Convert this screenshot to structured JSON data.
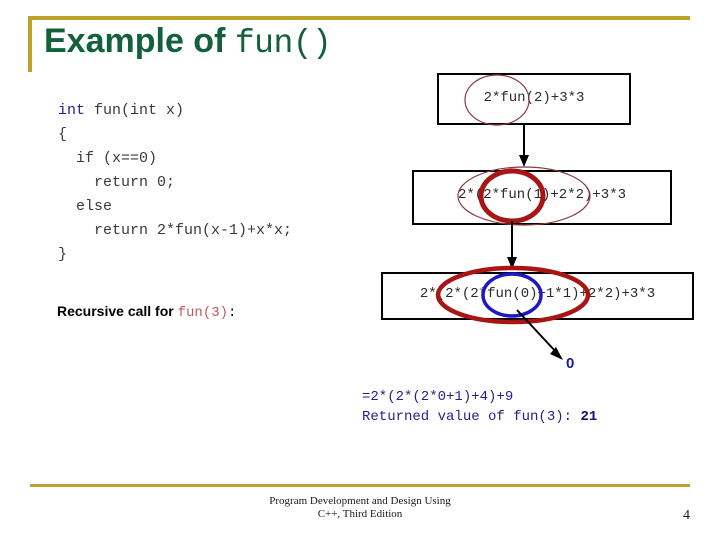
{
  "slide": {
    "title_prefix": "Example of ",
    "title_code": "fun()",
    "accent_color": "#bfa22a",
    "title_color": "#12603c"
  },
  "code_block": {
    "keyword_int": "int",
    "signature_rest": " fun(int x)",
    "line_open_brace": "{",
    "line_if": "  if (x==0)",
    "line_return_zero": "    return 0;",
    "line_else": "  else",
    "line_return_expr": "    return 2*fun(x-1)+x*x;",
    "line_close_brace": "}"
  },
  "recursive_label": {
    "prefix": "Recursive call for ",
    "call": "fun(3)",
    "suffix": ":"
  },
  "diagram": {
    "boxes": [
      {
        "id": "box1",
        "expression": "2*fun(2)+3*3",
        "highlight_color": "#8b3a3a",
        "highlight_target": "fun(2)"
      },
      {
        "id": "box2",
        "expression": "2*(2*fun(1)+2*2)+3*3",
        "highlight_color": "#a81515",
        "highlight_target": "fun(1)"
      },
      {
        "id": "box3",
        "expression": "2*(2*(2*fun(0)+1*1)+2*2)+3*3",
        "highlight_color": "#1a1ac0",
        "highlight_target": "fun(0)"
      }
    ],
    "returned_zero": "0"
  },
  "results": {
    "line_sum": "=2*(2*(2*0+1)+4)+9",
    "line_returned_prefix": "Returned value of fun(3): ",
    "line_returned_value": "21"
  },
  "footer": {
    "line1": "Program Development and Design Using",
    "line2": "C++, Third Edition",
    "page_number": "4"
  }
}
